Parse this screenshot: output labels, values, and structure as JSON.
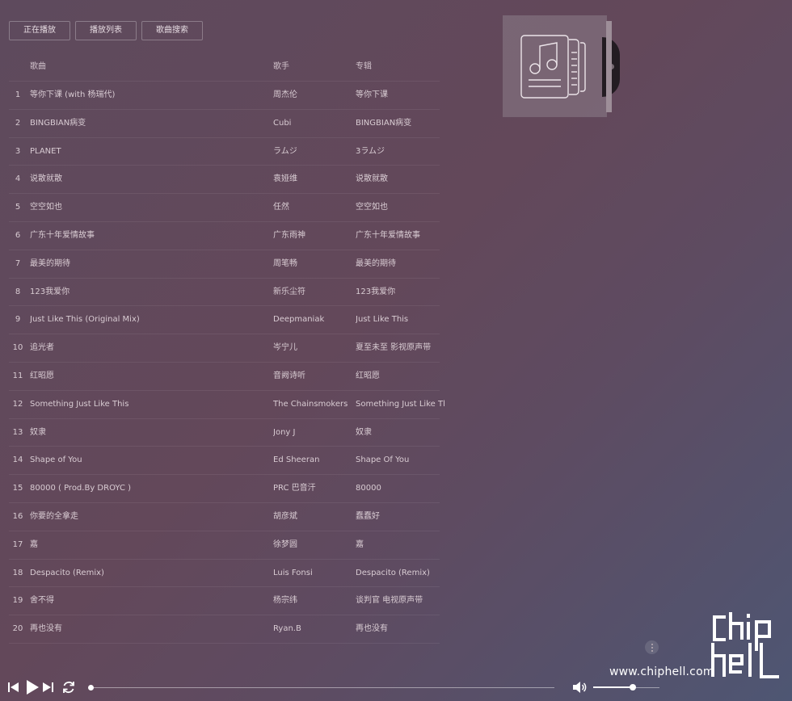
{
  "tabs": [
    {
      "label": "正在播放"
    },
    {
      "label": "播放列表"
    },
    {
      "label": "歌曲搜索"
    }
  ],
  "playlist": {
    "columns": {
      "song": "歌曲",
      "artist": "歌手",
      "album": "专辑"
    },
    "rows": [
      {
        "num": "1",
        "song": "等你下课 (with 杨瑞代)",
        "artist": "周杰伦",
        "album": "等你下课"
      },
      {
        "num": "2",
        "song": "BINGBIAN病变",
        "artist": "Cubi",
        "album": "BINGBIAN病变"
      },
      {
        "num": "3",
        "song": "PLANET",
        "artist": "ラムジ",
        "album": "3ラムジ"
      },
      {
        "num": "4",
        "song": "说散就散",
        "artist": "袁娅维",
        "album": "说散就散"
      },
      {
        "num": "5",
        "song": "空空如也",
        "artist": "任然",
        "album": "空空如也"
      },
      {
        "num": "6",
        "song": "广东十年爱情故事",
        "artist": "广东雨神",
        "album": "广东十年爱情故事"
      },
      {
        "num": "7",
        "song": "最美的期待",
        "artist": "周笔畅",
        "album": "最美的期待"
      },
      {
        "num": "8",
        "song": "123我爱你",
        "artist": "新乐尘符",
        "album": "123我爱你"
      },
      {
        "num": "9",
        "song": "Just Like This (Original Mix)",
        "artist": "Deepmaniak",
        "album": "Just Like This"
      },
      {
        "num": "10",
        "song": "追光者",
        "artist": "岑宁儿",
        "album": "夏至未至 影视原声带"
      },
      {
        "num": "11",
        "song": "红昭愿",
        "artist": "音阙诗听",
        "album": "红昭愿"
      },
      {
        "num": "12",
        "song": "Something Just Like This",
        "artist": "The Chainsmokers",
        "album": "Something Just Like This"
      },
      {
        "num": "13",
        "song": "奴隶",
        "artist": "Jony J",
        "album": "奴隶"
      },
      {
        "num": "14",
        "song": "Shape of You",
        "artist": "Ed Sheeran",
        "album": "Shape Of You"
      },
      {
        "num": "15",
        "song": "80000 ( Prod.By DROYC )",
        "artist": "PRC 巴音汗",
        "album": "80000"
      },
      {
        "num": "16",
        "song": "你要的全拿走",
        "artist": "胡彦斌",
        "album": "蠢蠢好"
      },
      {
        "num": "17",
        "song": "嘉",
        "artist": "徐梦圆",
        "album": "嘉"
      },
      {
        "num": "18",
        "song": "Despacito (Remix)",
        "artist": "Luis Fonsi",
        "album": "Despacito (Remix)"
      },
      {
        "num": "19",
        "song": "舍不得",
        "artist": "杨宗纬",
        "album": "谈判官 电视原声带"
      },
      {
        "num": "20",
        "song": "再也没有",
        "artist": "Ryan.B",
        "album": "再也没有"
      }
    ]
  },
  "player": {
    "progress": 0,
    "volume": 0.6
  },
  "cover": {
    "icon": "music-playlist-icon"
  },
  "watermark": {
    "url": "www.chiphell.com",
    "logo_text": "chip hell"
  },
  "colors": {
    "accent": "#ffffff",
    "text": "#d9ccd3"
  }
}
